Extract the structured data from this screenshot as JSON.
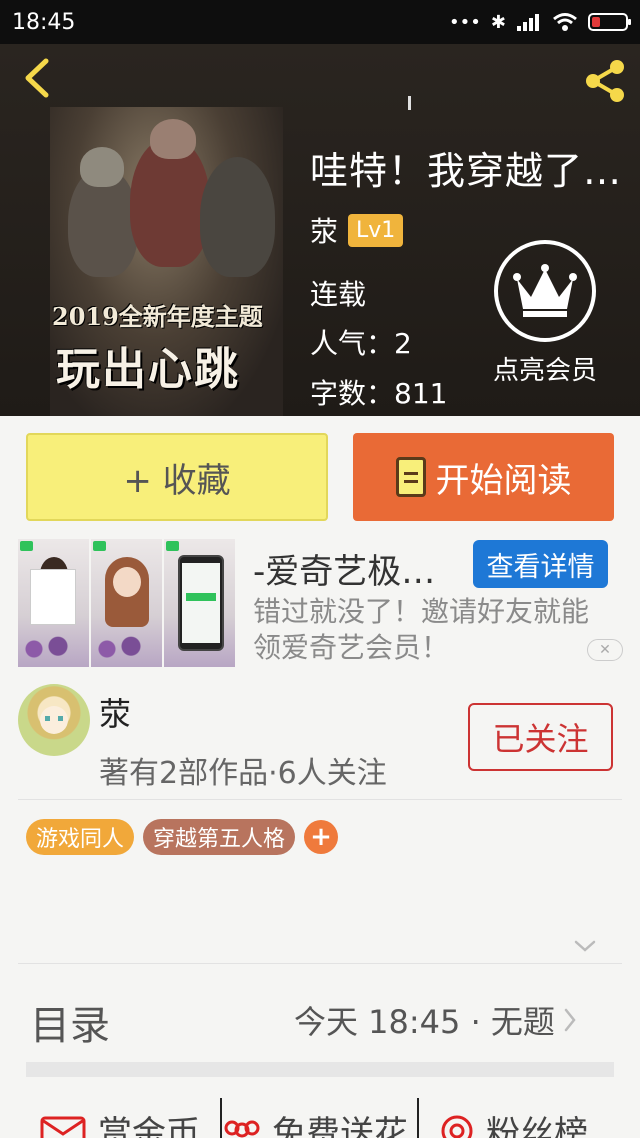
{
  "status_bar": {
    "time": "18:45",
    "icons": [
      "more-icon",
      "bluetooth-icon",
      "signal-icon",
      "wifi-icon",
      "battery-icon"
    ]
  },
  "book": {
    "cover_line1": "2019全新年度主题",
    "cover_line2": "玩出心跳",
    "title": "哇特！我穿越了…",
    "author": "荥",
    "level": "Lv1",
    "status": "连载",
    "popularity": "人气：2",
    "word_count": "字数：811",
    "vip_label": "点亮会员"
  },
  "actions": {
    "collect_label": "+ 收藏",
    "read_label": "开始阅读"
  },
  "ad": {
    "title": "-爱奇艺极…",
    "detail_button": "查看详情",
    "description": "错过就没了！邀请好友就能领爱奇艺会员！",
    "close_icon": "close-icon"
  },
  "author_section": {
    "name": "荥",
    "stats": "著有2部作品·6人关注",
    "follow_button": "已关注"
  },
  "tags": [
    {
      "label": "游戏同人",
      "color": "#f1a83a"
    },
    {
      "label": "穿越第五人格",
      "color": "#b8745e"
    }
  ],
  "tag_add": "+",
  "toc": {
    "title": "目录",
    "latest": "今天 18:45 · 无题"
  },
  "bottom": {
    "coins": "赏金币",
    "flowers": "免费送花",
    "fans": "粉丝榜"
  },
  "colors": {
    "accent_orange": "#e96a36",
    "collect_yellow": "#f8ef7a",
    "ad_blue": "#1e78d6",
    "follow_red": "#cc3333"
  }
}
